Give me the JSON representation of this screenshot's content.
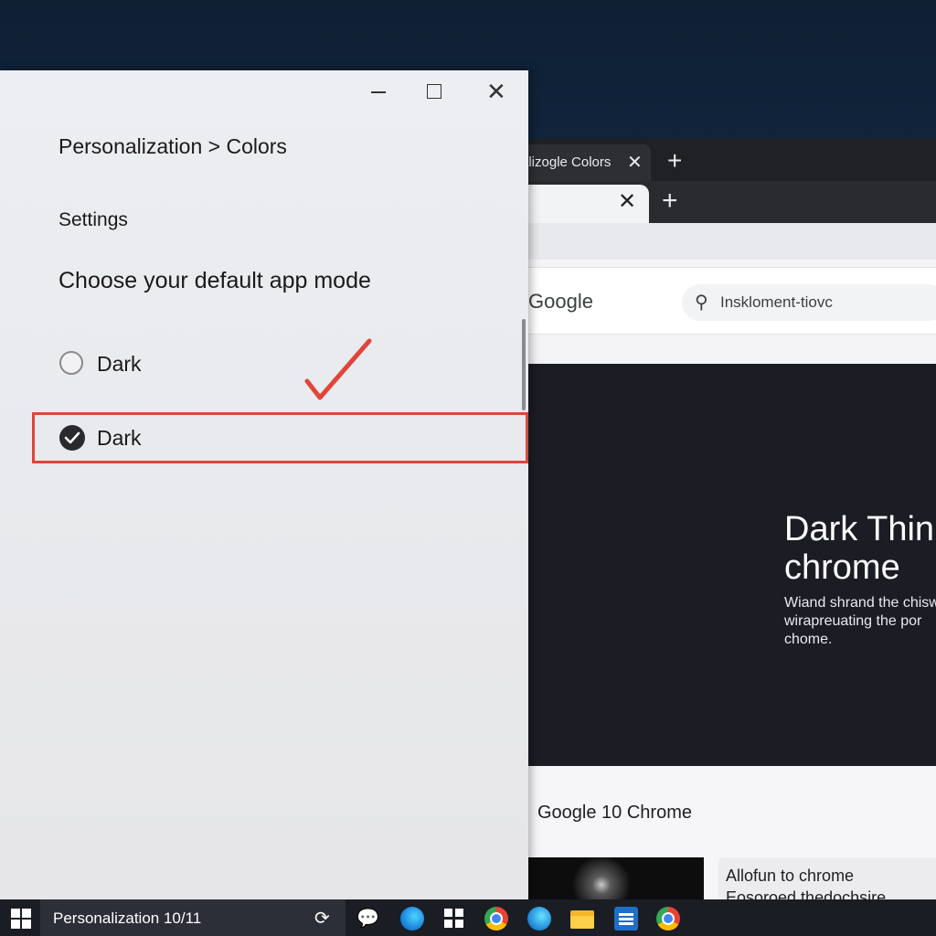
{
  "browser": {
    "tab1_title": "alizogle Colors",
    "tab_close_glyph": "✕",
    "new_tab_glyph": "+",
    "logo_text": "Google",
    "search_text": "Insklоment-tiovc",
    "hero_title": "Dark Thin chrome",
    "hero_body": "Wiand shrand the chisw wirapreuating the por chome.",
    "caption": "Google 10 Chrome",
    "card_line1": "Allofun to chrome",
    "card_line2": "Eosoroed thedochsire"
  },
  "settings": {
    "breadcrumb": "Personalization > Colors",
    "app_label": "Settings",
    "section_title": "Choose your default app mode",
    "options": [
      {
        "label": "Dark",
        "selected": false
      },
      {
        "label": "Dark",
        "selected": true
      }
    ],
    "highlight_color": "#e0453a"
  },
  "taskbar": {
    "active_app_label": "Personalization 10/11"
  }
}
